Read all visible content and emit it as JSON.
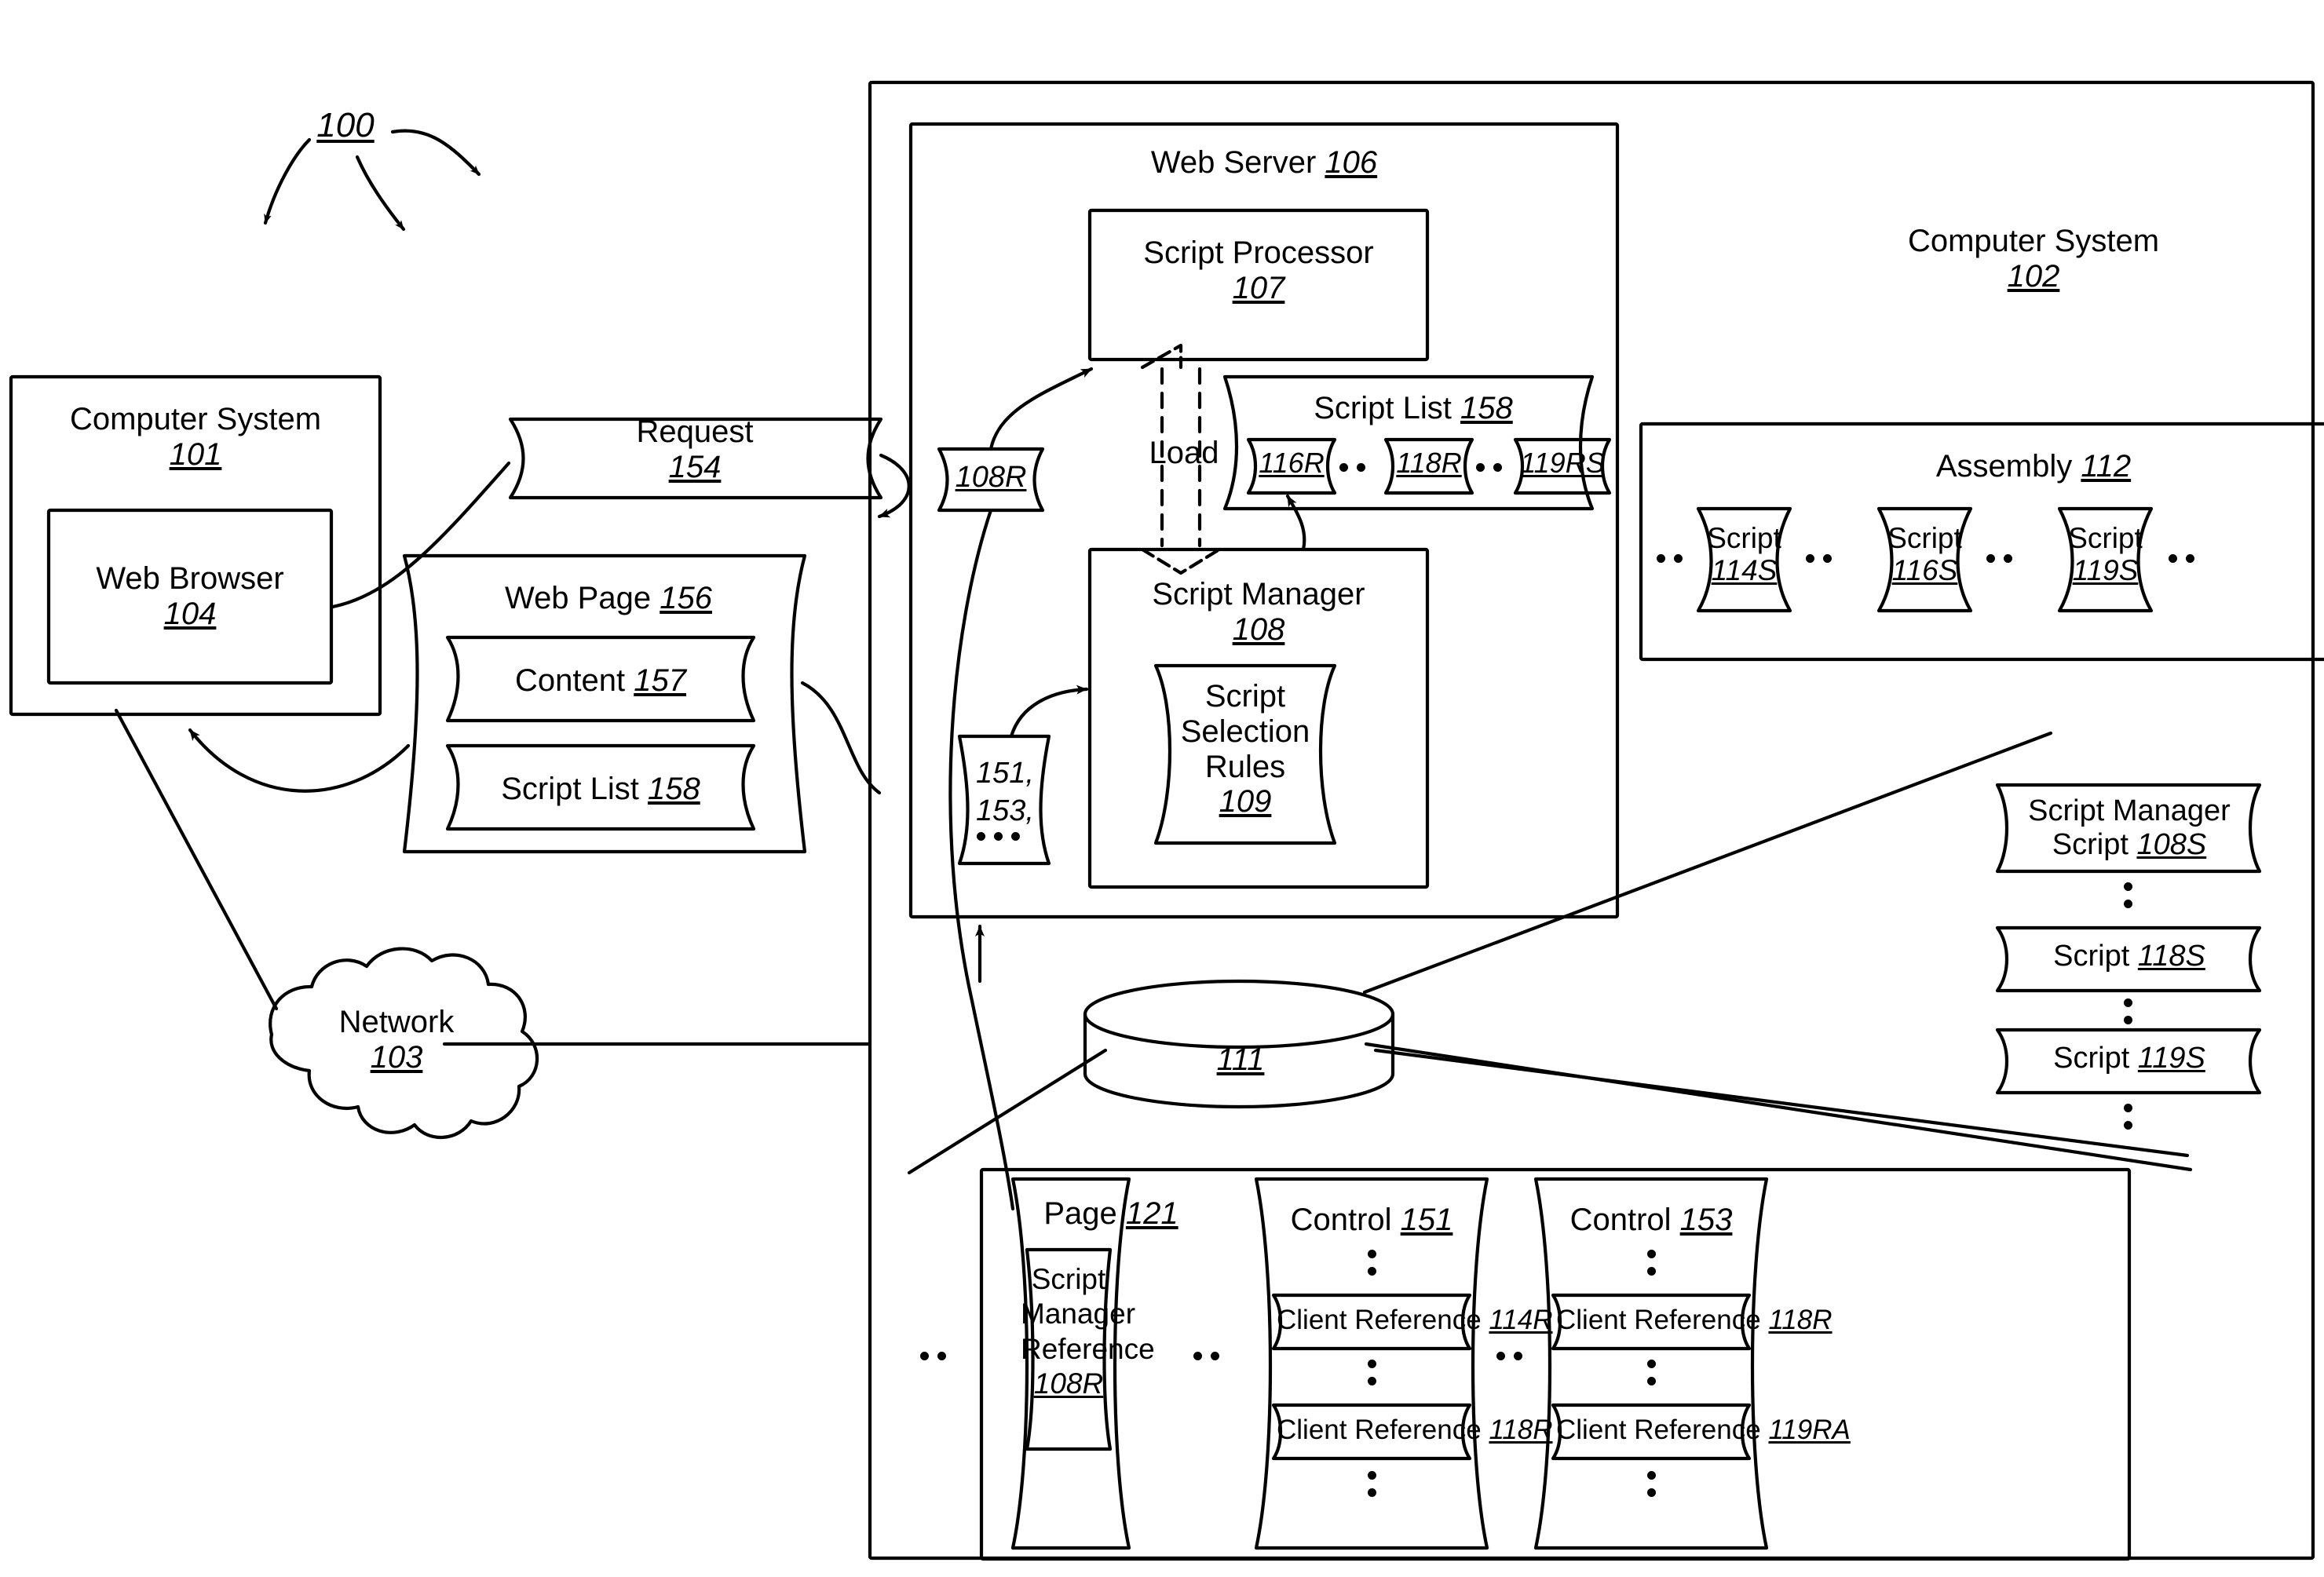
{
  "figure": {
    "callout_number": "100"
  },
  "client": {
    "computer_system": {
      "title": "Computer System",
      "ref": "101"
    },
    "web_browser": {
      "title": "Web Browser",
      "ref": "104"
    }
  },
  "network": {
    "title": "Network",
    "ref": "103"
  },
  "request": {
    "title": "Request",
    "ref": "154"
  },
  "web_page": {
    "title": "Web Page",
    "ref": "156",
    "content": {
      "title": "Content",
      "ref": "157"
    },
    "script_list": {
      "title": "Script List",
      "ref": "158"
    }
  },
  "server": {
    "computer_system": {
      "title": "Computer System",
      "ref": "102"
    },
    "web_server": {
      "title": "Web Server",
      "ref": "106"
    },
    "script_processor": {
      "title": "Script Processor",
      "ref": "107"
    },
    "script_manager": {
      "title": "Script Manager",
      "ref": "108"
    },
    "script_selection_rules": {
      "title": "Script Selection Rules",
      "ref": "109"
    },
    "load_label": "Load",
    "script_manager_ref_token": "108R",
    "controls_token": "151, 153,",
    "script_list": {
      "title": "Script List",
      "ref": "158",
      "items": [
        "116R",
        "118R",
        "119RS"
      ]
    },
    "assembly": {
      "title": "Assembly",
      "ref": "112",
      "scripts": [
        {
          "title": "Script",
          "ref": "114S"
        },
        {
          "title": "Script",
          "ref": "116S"
        },
        {
          "title": "Script",
          "ref": "119S"
        }
      ]
    },
    "database": {
      "ref": "111"
    },
    "store_scripts": [
      {
        "title": "Script Manager Script",
        "ref": "108S",
        "line1": "Script Manager",
        "line2": "Script"
      },
      {
        "title": "Script",
        "ref": "118S",
        "line1": "Script",
        "line2": ""
      },
      {
        "title": "Script",
        "ref": "119S",
        "line1": "Script",
        "line2": ""
      }
    ],
    "page": {
      "title": "Page",
      "ref": "121",
      "script_manager_reference": {
        "line1": "Script",
        "line2": "Manager",
        "line3": "Reference",
        "ref": "108R"
      }
    },
    "controls": [
      {
        "title": "Control",
        "ref": "151",
        "client_references": [
          {
            "title": "Client Reference",
            "ref": "114R"
          },
          {
            "title": "Client Reference",
            "ref": "118R"
          }
        ]
      },
      {
        "title": "Control",
        "ref": "153",
        "client_references": [
          {
            "title": "Client Reference",
            "ref": "118R"
          },
          {
            "title": "Client Reference",
            "ref": "119RA"
          }
        ]
      }
    ]
  }
}
